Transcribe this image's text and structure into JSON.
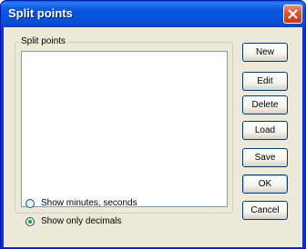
{
  "window": {
    "title": "Split points"
  },
  "group": {
    "label": "Split points",
    "items": []
  },
  "buttons": {
    "new": "New",
    "edit": "Edit",
    "delete": "Delete",
    "load": "Load",
    "save": "Save",
    "ok": "OK",
    "cancel": "Cancel"
  },
  "display_options": {
    "minutes_seconds": {
      "label": "Show minutes, seconds",
      "checked": false
    },
    "only_decimals": {
      "label": "Show only decimals",
      "checked": true
    }
  },
  "colors": {
    "title_bar": "#0553da",
    "dialog_face": "#ece9d8",
    "close_button": "#d9552f",
    "radio_dot": "#21a121"
  }
}
